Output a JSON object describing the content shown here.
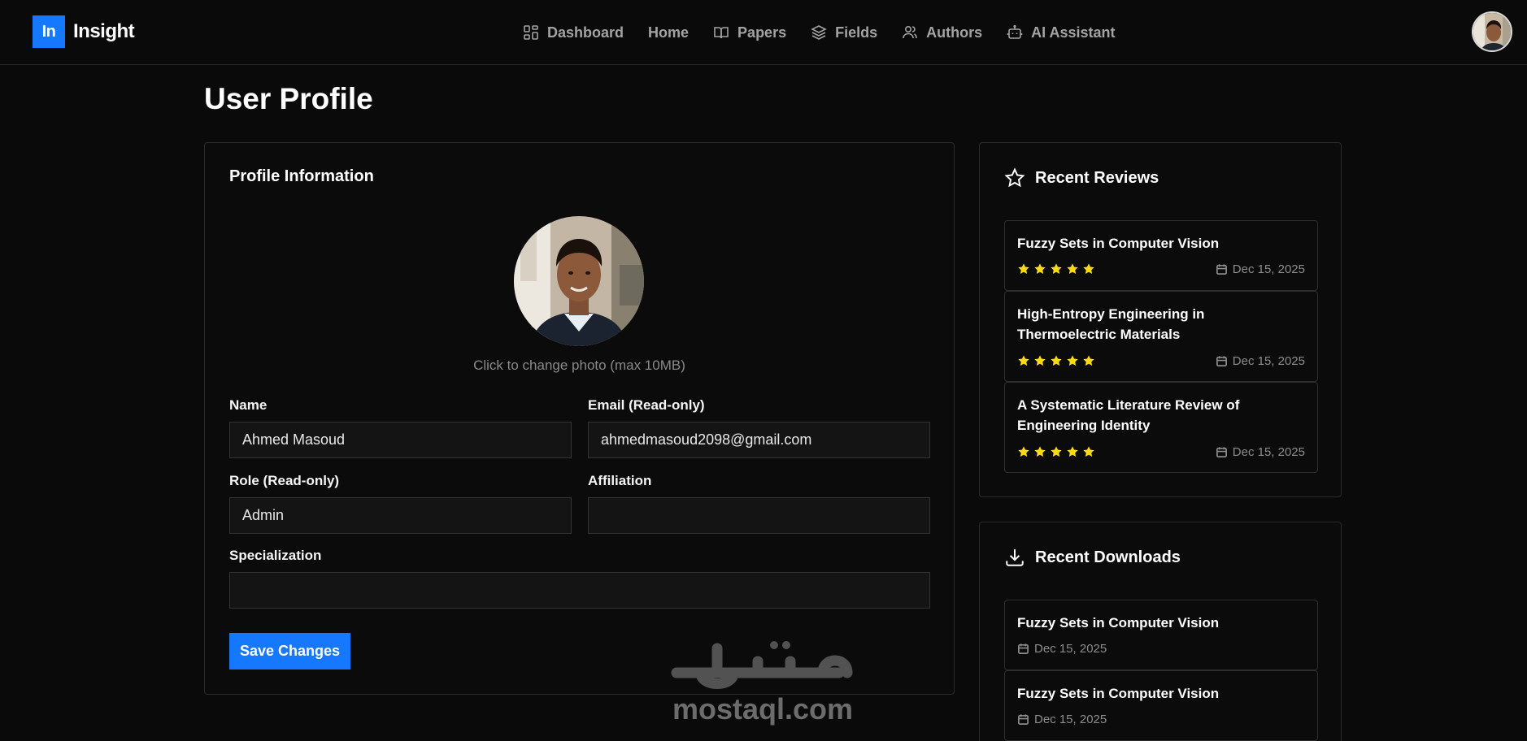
{
  "brand": {
    "logo_mark": "In",
    "name": "Insight",
    "accent": "#1677ff"
  },
  "nav": [
    {
      "label": "Dashboard",
      "icon": "dashboard-grid-icon"
    },
    {
      "label": "Home",
      "icon": ""
    },
    {
      "label": "Papers",
      "icon": "book-open-icon"
    },
    {
      "label": "Fields",
      "icon": "layers-icon"
    },
    {
      "label": "Authors",
      "icon": "users-icon"
    },
    {
      "label": "AI Assistant",
      "icon": "robot-icon"
    }
  ],
  "page": {
    "title": "User Profile"
  },
  "profile": {
    "heading": "Profile Information",
    "photo_hint": "Click to change photo (max 10MB)",
    "name_label": "Name",
    "name_value": "Ahmed Masoud",
    "email_label": "Email (Read-only)",
    "email_value": "ahmedmasoud2098@gmail.com",
    "role_label": "Role (Read-only)",
    "role_value": "Admin",
    "affiliation_label": "Affiliation",
    "affiliation_value": "",
    "specialization_label": "Specialization",
    "specialization_value": "",
    "save_label": "Save Changes"
  },
  "reviews": {
    "heading": "Recent Reviews",
    "items": [
      {
        "title": "Fuzzy Sets in Computer Vision",
        "rating": 5,
        "date": "Dec 15, 2025"
      },
      {
        "title": "High-Entropy Engineering in Thermoelectric Materials",
        "rating": 5,
        "date": "Dec 15, 2025"
      },
      {
        "title": "A Systematic Literature Review of Engineering Identity",
        "rating": 5,
        "date": "Dec 15, 2025"
      }
    ]
  },
  "downloads": {
    "heading": "Recent Downloads",
    "items": [
      {
        "title": "Fuzzy Sets in Computer Vision",
        "date": "Dec 15, 2025"
      },
      {
        "title": "Fuzzy Sets in Computer Vision",
        "date": "Dec 15, 2025"
      }
    ]
  },
  "watermark": {
    "text": "mostaql.com"
  },
  "colors": {
    "star": "#fadb14",
    "background": "#0a0a0a",
    "border": "#2b2b2b"
  }
}
